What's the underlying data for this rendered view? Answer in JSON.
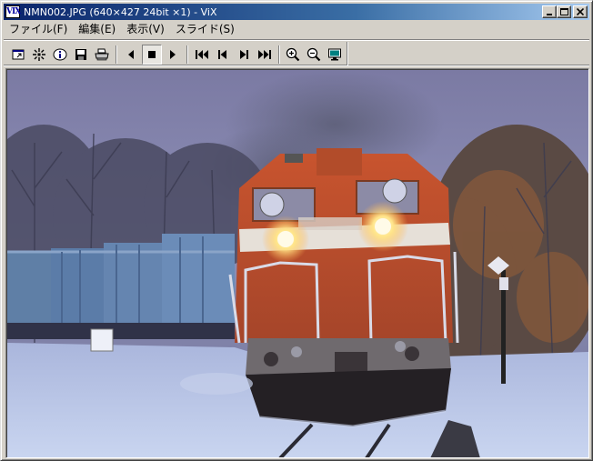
{
  "window": {
    "app_icon_text": "VIX",
    "title": "NMN002.JPG (640×427 24bit ×1) - ViX"
  },
  "menu": {
    "items": [
      {
        "label": "ファイル(F)"
      },
      {
        "label": "編集(E)"
      },
      {
        "label": "表示(V)"
      },
      {
        "label": "スライド(S)"
      }
    ]
  },
  "toolbar": {
    "tools": [
      "open-window-icon",
      "effects-icon",
      "info-icon",
      "save-icon",
      "print-icon",
      "play-reverse-icon",
      "stop-icon",
      "play-icon",
      "first-icon",
      "previous-icon",
      "next-icon",
      "last-icon",
      "zoom-in-icon",
      "zoom-out-icon",
      "fullscreen-icon"
    ]
  },
  "colors": {
    "titlebar_start": "#0a246a",
    "titlebar_end": "#a6caf0",
    "face": "#d4d0c8"
  }
}
